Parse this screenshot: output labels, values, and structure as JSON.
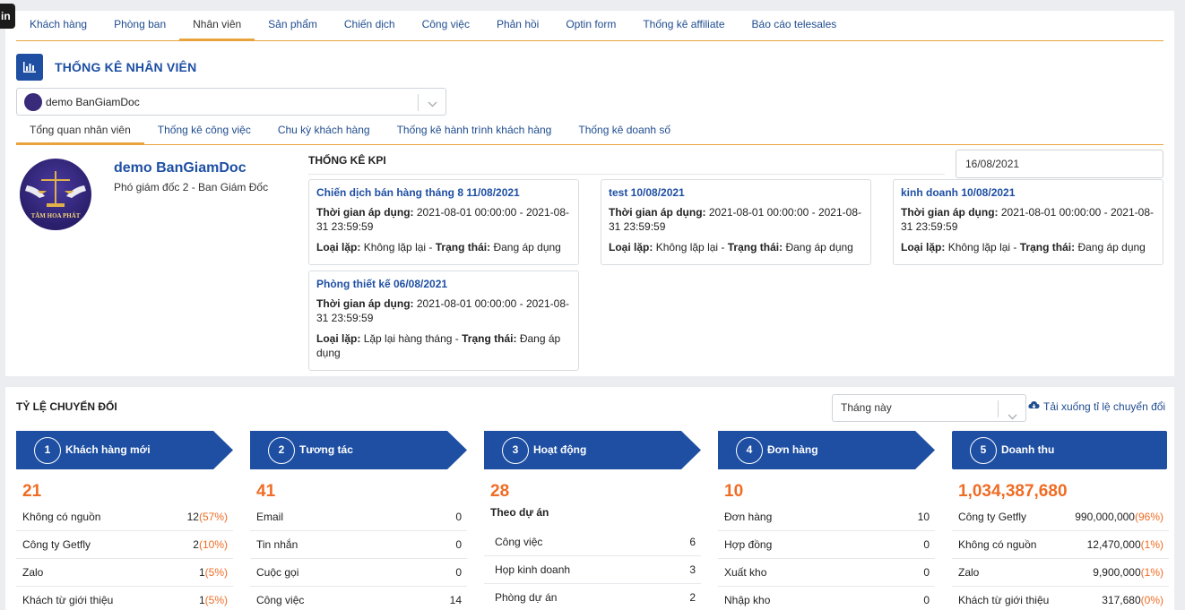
{
  "corner_tag": "in",
  "main_tabs": [
    {
      "label": "Khách hàng"
    },
    {
      "label": "Phòng ban"
    },
    {
      "label": "Nhân viên"
    },
    {
      "label": "Sản phẩm"
    },
    {
      "label": "Chiến dịch"
    },
    {
      "label": "Công việc"
    },
    {
      "label": "Phản hồi"
    },
    {
      "label": "Optin form"
    },
    {
      "label": "Thống kê affiliate"
    },
    {
      "label": "Báo cáo telesales"
    }
  ],
  "section_title": "THỐNG KÊ NHÂN VIÊN",
  "employee_select": {
    "value": "demo BanGiamDoc"
  },
  "sub_tabs": [
    {
      "label": "Tổng quan nhân viên"
    },
    {
      "label": "Thống kê công việc"
    },
    {
      "label": "Chu kỳ khách hàng"
    },
    {
      "label": "Thống kê hành trình khách hàng"
    },
    {
      "label": "Thống kê doanh số"
    }
  ],
  "profile": {
    "name": "demo BanGiamDoc",
    "role": "Phó giám đốc 2 - Ban Giám Đốc",
    "logo_text": "TÂM HOA PHÁT"
  },
  "kpi": {
    "title": "THỐNG KÊ KPI",
    "date": "16/08/2021",
    "cards": [
      {
        "title": "Chiến dịch bán hàng tháng 8 11/08/2021",
        "time_label": "Thời gian áp dụng:",
        "time_value": "2021-08-01 00:00:00 - 2021-08-31 23:59:59",
        "repeat_label": "Loại lặp:",
        "repeat_value": "Không lặp lại",
        "status_label": "Trạng thái:",
        "status_value": "Đang áp dụng"
      },
      {
        "title": "test 10/08/2021",
        "time_label": "Thời gian áp dụng:",
        "time_value": "2021-08-01 00:00:00 - 2021-08-31 23:59:59",
        "repeat_label": "Loại lặp:",
        "repeat_value": "Không lặp lại",
        "status_label": "Trạng thái:",
        "status_value": "Đang áp dụng"
      },
      {
        "title": "kinh doanh 10/08/2021",
        "time_label": "Thời gian áp dụng:",
        "time_value": "2021-08-01 00:00:00 - 2021-08-31 23:59:59",
        "repeat_label": "Loại lặp:",
        "repeat_value": "Không lặp lại",
        "status_label": "Trạng thái:",
        "status_value": "Đang áp dụng"
      },
      {
        "title": "Phòng thiết kế 06/08/2021",
        "time_label": "Thời gian áp dụng:",
        "time_value": "2021-08-01 00:00:00 - 2021-08-31 23:59:59",
        "repeat_label": "Loại lặp:",
        "repeat_value": "Lặp lại hàng tháng",
        "status_label": "Trạng thái:",
        "status_value": "Đang áp dụng"
      }
    ]
  },
  "conversion": {
    "title": "TỶ LỆ CHUYỂN ĐỔI",
    "period": "Tháng này",
    "download_label": "Tải xuống tỉ lệ chuyển đổi",
    "banner_color": "#1e4fa3",
    "total_color": "#ef6c24",
    "stages": [
      {
        "num": "1",
        "label": "Khách hàng mới",
        "total": "21",
        "rows": [
          {
            "name": "Không có nguồn",
            "value": "12",
            "pct": "(57%)"
          },
          {
            "name": "Công ty Getfly",
            "value": "2",
            "pct": "(10%)"
          },
          {
            "name": "Zalo",
            "value": "1",
            "pct": "(5%)"
          },
          {
            "name": "Khách từ giới thiệu",
            "value": "1",
            "pct": "(5%)"
          }
        ]
      },
      {
        "num": "2",
        "label": "Tương tác",
        "total": "41",
        "rows": [
          {
            "name": "Email",
            "value": "0",
            "pct": ""
          },
          {
            "name": "Tin nhắn",
            "value": "0",
            "pct": ""
          },
          {
            "name": "Cuộc gọi",
            "value": "0",
            "pct": ""
          },
          {
            "name": "Công việc",
            "value": "14",
            "pct": ""
          }
        ]
      },
      {
        "num": "3",
        "label": "Hoạt động",
        "total": "28",
        "subtitle": "Theo dự án",
        "rows": [
          {
            "name": "Công việc",
            "value": "6",
            "pct": ""
          },
          {
            "name": "Họp kinh doanh",
            "value": "3",
            "pct": ""
          },
          {
            "name": "Phòng dự án",
            "value": "2",
            "pct": ""
          }
        ]
      },
      {
        "num": "4",
        "label": "Đơn hàng",
        "total": "10",
        "rows": [
          {
            "name": "Đơn hàng",
            "value": "10",
            "pct": ""
          },
          {
            "name": "Hợp đồng",
            "value": "0",
            "pct": ""
          },
          {
            "name": "Xuất kho",
            "value": "0",
            "pct": ""
          },
          {
            "name": "Nhập kho",
            "value": "0",
            "pct": ""
          }
        ]
      },
      {
        "num": "5",
        "label": "Doanh thu",
        "total": "1,034,387,680",
        "rows": [
          {
            "name": "Công ty Getfly",
            "value": "990,000,000",
            "pct": "(96%)"
          },
          {
            "name": "Không có nguồn",
            "value": "12,470,000",
            "pct": "(1%)"
          },
          {
            "name": "Zalo",
            "value": "9,900,000",
            "pct": "(1%)"
          },
          {
            "name": "Khách từ giới thiệu",
            "value": "317,680",
            "pct": "(0%)"
          }
        ]
      }
    ]
  }
}
